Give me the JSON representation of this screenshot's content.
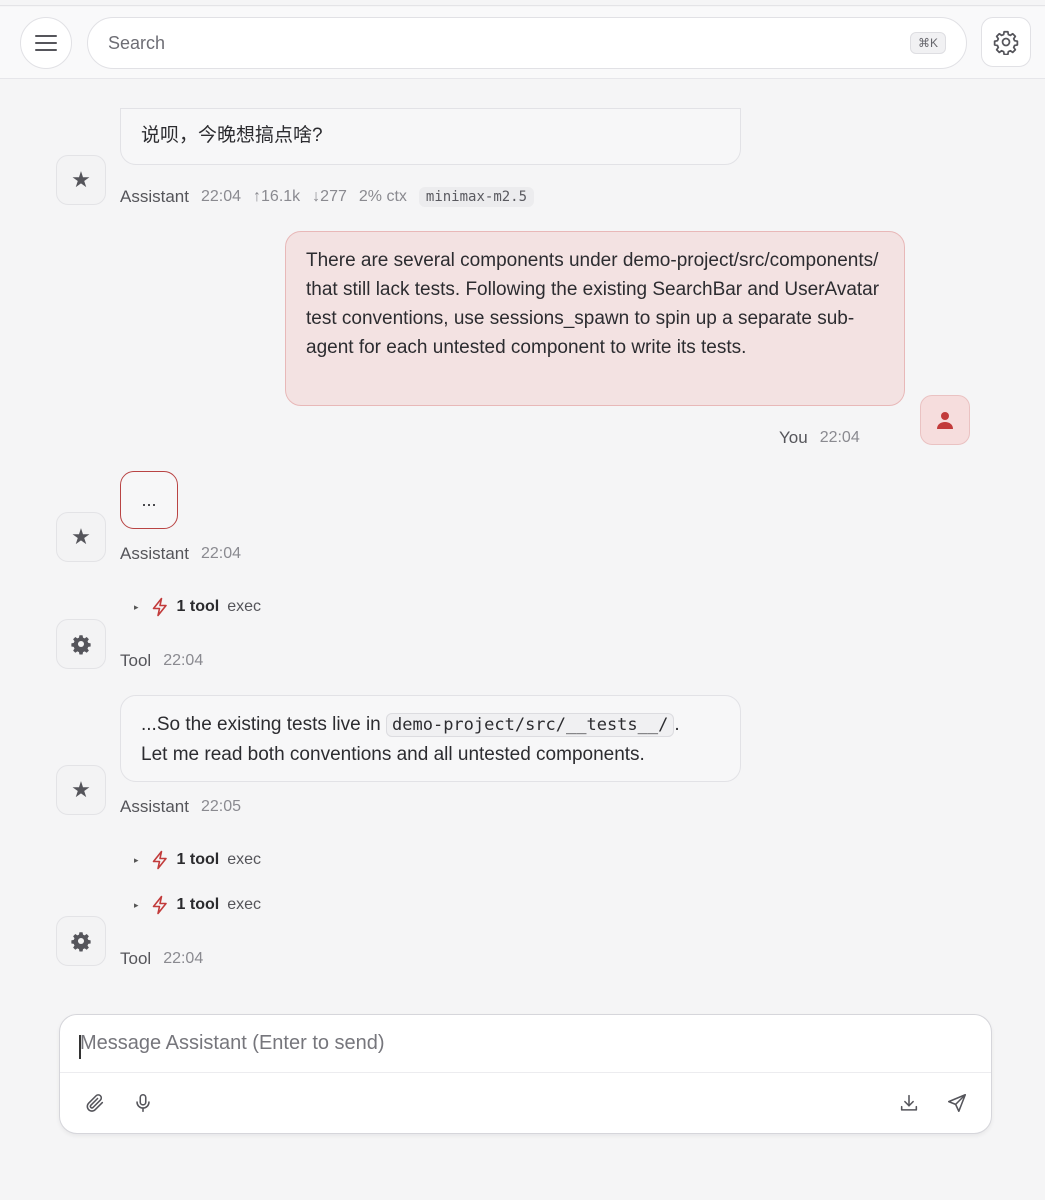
{
  "header": {
    "search_placeholder": "Search",
    "search_shortcut": "⌘K"
  },
  "messages": {
    "m1": {
      "text": "说呗，今晚想搞点啥?",
      "author": "Assistant",
      "time": "22:04",
      "tokens_up": "↑16.1k",
      "tokens_down": "↓277",
      "ctx": "2% ctx",
      "model": "minimax-m2.5"
    },
    "m2": {
      "text": "There are several components under demo-project/src/components/ that still lack tests. Following the existing SearchBar and UserAvatar test conventions, use sessions_spawn to spin up a separate sub-agent for each untested component to write its tests.",
      "author": "You",
      "time": "22:04"
    },
    "m3": {
      "text": "...",
      "author": "Assistant",
      "time": "22:04"
    },
    "m4": {
      "tool_count": "1 tool",
      "tool_name": "exec",
      "author": "Tool",
      "time": "22:04"
    },
    "m5": {
      "text_before": "...So the existing tests live in ",
      "code": "demo-project/src/__tests__/",
      "text_after": ".",
      "line2": "Let me read both conventions and all untested components.",
      "author": "Assistant",
      "time": "22:05"
    },
    "m6": {
      "tools": [
        {
          "count": "1 tool",
          "name": "exec"
        },
        {
          "count": "1 tool",
          "name": "exec"
        }
      ],
      "author": "Tool",
      "time": "22:04"
    }
  },
  "composer": {
    "placeholder": "Message Assistant (Enter to send)"
  },
  "colors": {
    "accent": "#c23b3b",
    "user_bubble": "#f3e2e2",
    "user_border": "#e8b8b8"
  },
  "icons": [
    "menu-icon",
    "gear-icon",
    "star-icon",
    "user-icon",
    "chevron-right-icon",
    "bolt-icon",
    "paperclip-icon",
    "microphone-icon",
    "download-icon",
    "send-icon"
  ]
}
